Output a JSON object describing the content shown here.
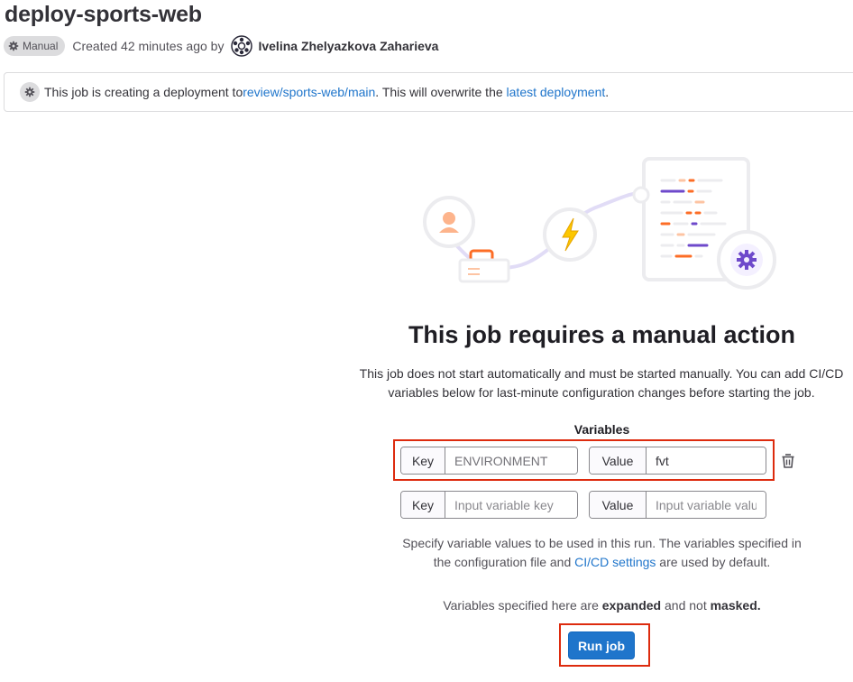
{
  "job": {
    "title": "deploy-sports-web",
    "badge": "Manual",
    "created": "Created 42 minutes ago by",
    "author": "Ivelina Zhelyazkova Zaharieva"
  },
  "alert": {
    "prefix": "This job is creating a deployment to ",
    "env_link": "review/sports-web/main",
    "middle": ". This will overwrite the ",
    "latest_link": "latest deployment",
    "suffix": "."
  },
  "empty_state": {
    "heading": "This job requires a manual action",
    "description": "This job does not start automatically and must be started manually. You can add CI/CD variables below for last-minute configuration changes before starting the job.",
    "variables_label": "Variables"
  },
  "variables": [
    {
      "key_label": "Key",
      "key_value": "ENVIRONMENT",
      "value_label": "Value",
      "value_value": "fvt"
    }
  ],
  "new_variable": {
    "key_label": "Key",
    "key_placeholder": "Input variable key",
    "value_label": "Value",
    "value_placeholder": "Input variable value"
  },
  "hint": {
    "prefix": "Specify variable values to be used in this run. The variables specified in the configuration file and ",
    "link": "CI/CD settings",
    "suffix": " are used by default."
  },
  "expanded_note": {
    "prefix": "Variables specified here are ",
    "expanded": "expanded",
    "middle": " and not ",
    "masked": "masked."
  },
  "run_button": "Run job",
  "colors": {
    "primary": "#1f75cb",
    "highlight_border": "#dd2b0e",
    "badge_bg": "#dcdcde",
    "illustration_orange": "#fc6d26",
    "illustration_purple": "#6e49cb"
  }
}
